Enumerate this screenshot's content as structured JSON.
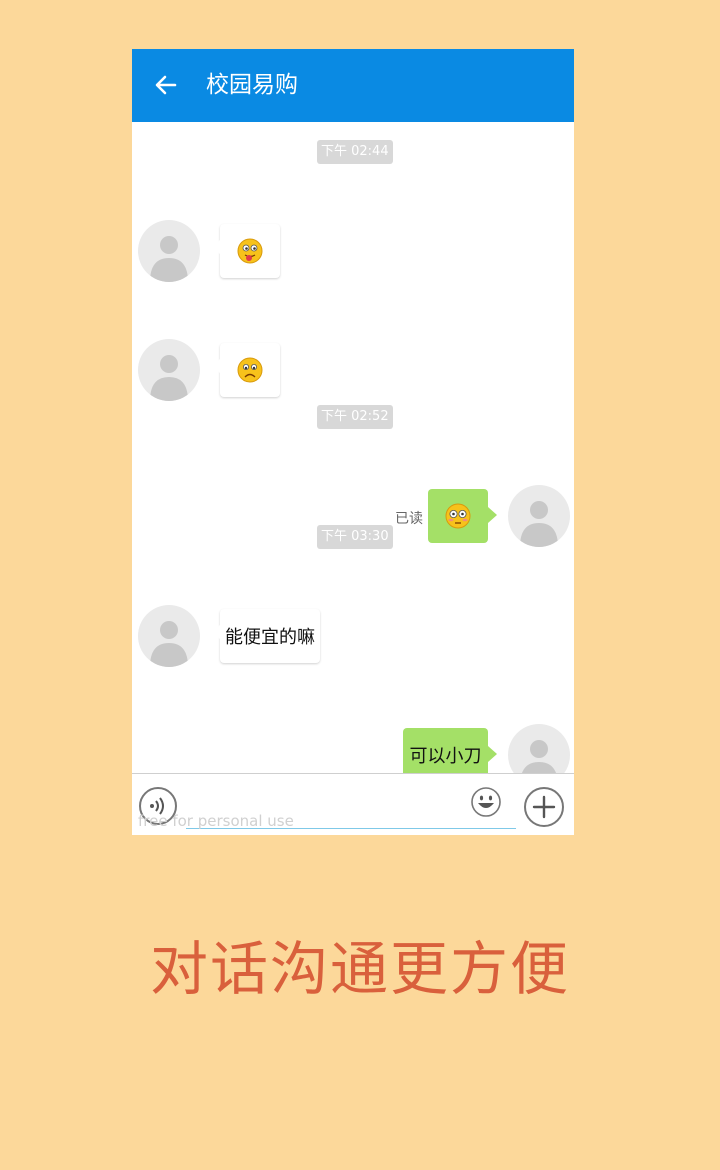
{
  "app": {
    "title": "校园易购",
    "back_icon": "arrow-left-icon"
  },
  "messages": {
    "time_1": "下午 02:44",
    "time_2": "下午 02:52",
    "time_3": "下午 03:30",
    "msg_1_emoji": "yum-face-icon",
    "msg_2_emoji": "sad-face-icon",
    "msg_3_emoji": "flushed-face-icon",
    "msg_3_status": "已读",
    "msg_4_text": "能便宜的嘛",
    "msg_5_text": "可以小刀"
  },
  "input_bar": {
    "voice_icon": "voice-icon",
    "input_value": "",
    "watermark": "free for personal use",
    "emoji_icon": "emoji-icon",
    "plus_icon": "plus-icon"
  },
  "caption": "对话沟通更方便",
  "colors": {
    "background": "#fcd89a",
    "appbar": "#0a8ae3",
    "bubble_right": "#a4e067",
    "caption": "#d9603c"
  }
}
